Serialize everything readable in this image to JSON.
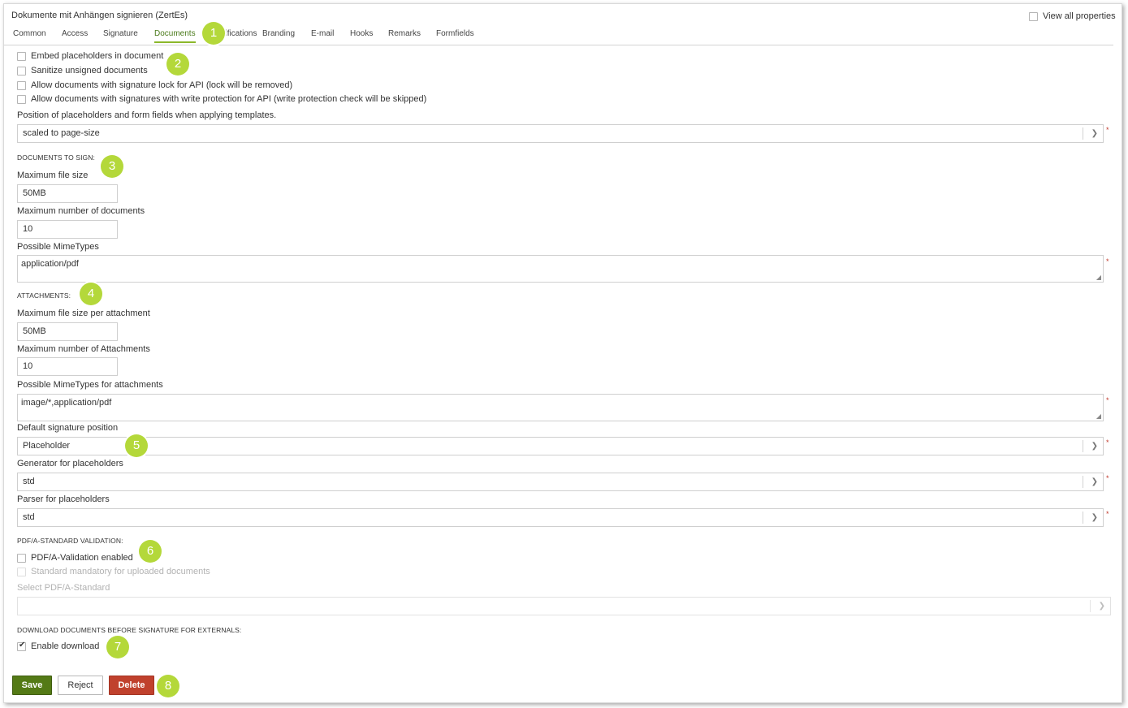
{
  "window": {
    "title": "Dokumente mit Anhängen signieren (ZertEs)"
  },
  "view_all": {
    "label": "View all properties",
    "checked": false
  },
  "tabs": [
    {
      "label": "Common"
    },
    {
      "label": "Access"
    },
    {
      "label": "Signature"
    },
    {
      "label": "Documents",
      "active": true
    },
    {
      "label": "Notifications"
    },
    {
      "label": "Branding"
    },
    {
      "label": "E-mail"
    },
    {
      "label": "Hooks"
    },
    {
      "label": "Remarks"
    },
    {
      "label": "Formfields"
    }
  ],
  "general": {
    "checkboxes": [
      {
        "label": "Embed placeholders in document",
        "checked": false
      },
      {
        "label": "Sanitize unsigned documents",
        "checked": false
      },
      {
        "label": "Allow documents with signature lock for API (lock will be removed)",
        "checked": false
      },
      {
        "label": "Allow documents with signatures with write protection for API (write protection check will be skipped)",
        "checked": false
      }
    ],
    "position_label": "Position of placeholders and form fields when applying templates.",
    "position_value": "scaled to page-size"
  },
  "documents": {
    "section": "DOCUMENTS TO SIGN:",
    "max_size_label": "Maximum file size",
    "max_size_value": "50MB",
    "max_count_label": "Maximum number of documents",
    "max_count_value": "10",
    "mimetypes_label": "Possible MimeTypes",
    "mimetypes_value": "application/pdf"
  },
  "attachments": {
    "section": "ATTACHMENTS:",
    "max_size_label": "Maximum file size per attachment",
    "max_size_value": "50MB",
    "max_count_label": "Maximum number of Attachments",
    "max_count_value": "10",
    "mimetypes_label": "Possible MimeTypes for attachments",
    "mimetypes_value": "image/*,application/pdf"
  },
  "signature": {
    "default_position_label": "Default signature position",
    "default_position_value": "Placeholder",
    "generator_label": "Generator for placeholders",
    "generator_value": "std",
    "parser_label": "Parser for placeholders",
    "parser_value": "std"
  },
  "pdfa": {
    "section": "PDF/A-STANDARD VALIDATION:",
    "enabled_label": "PDF/A-Validation enabled",
    "enabled_checked": false,
    "mandatory_label": "Standard mandatory for uploaded documents",
    "select_label": "Select PDF/A-Standard",
    "select_value": ""
  },
  "download": {
    "section": "DOWNLOAD DOCUMENTS BEFORE SIGNATURE FOR EXTERNALS:",
    "enable_label": "Enable download",
    "enable_checked": true
  },
  "required_marker": "*",
  "buttons": {
    "save": "Save",
    "reject": "Reject",
    "delete": "Delete"
  },
  "badges": [
    "1",
    "2",
    "3",
    "4",
    "5",
    "6",
    "7",
    "8"
  ],
  "colors": {
    "accent": "#8cb82b",
    "badge": "#b4d83a",
    "save": "#547a16",
    "delete": "#c0412d"
  }
}
